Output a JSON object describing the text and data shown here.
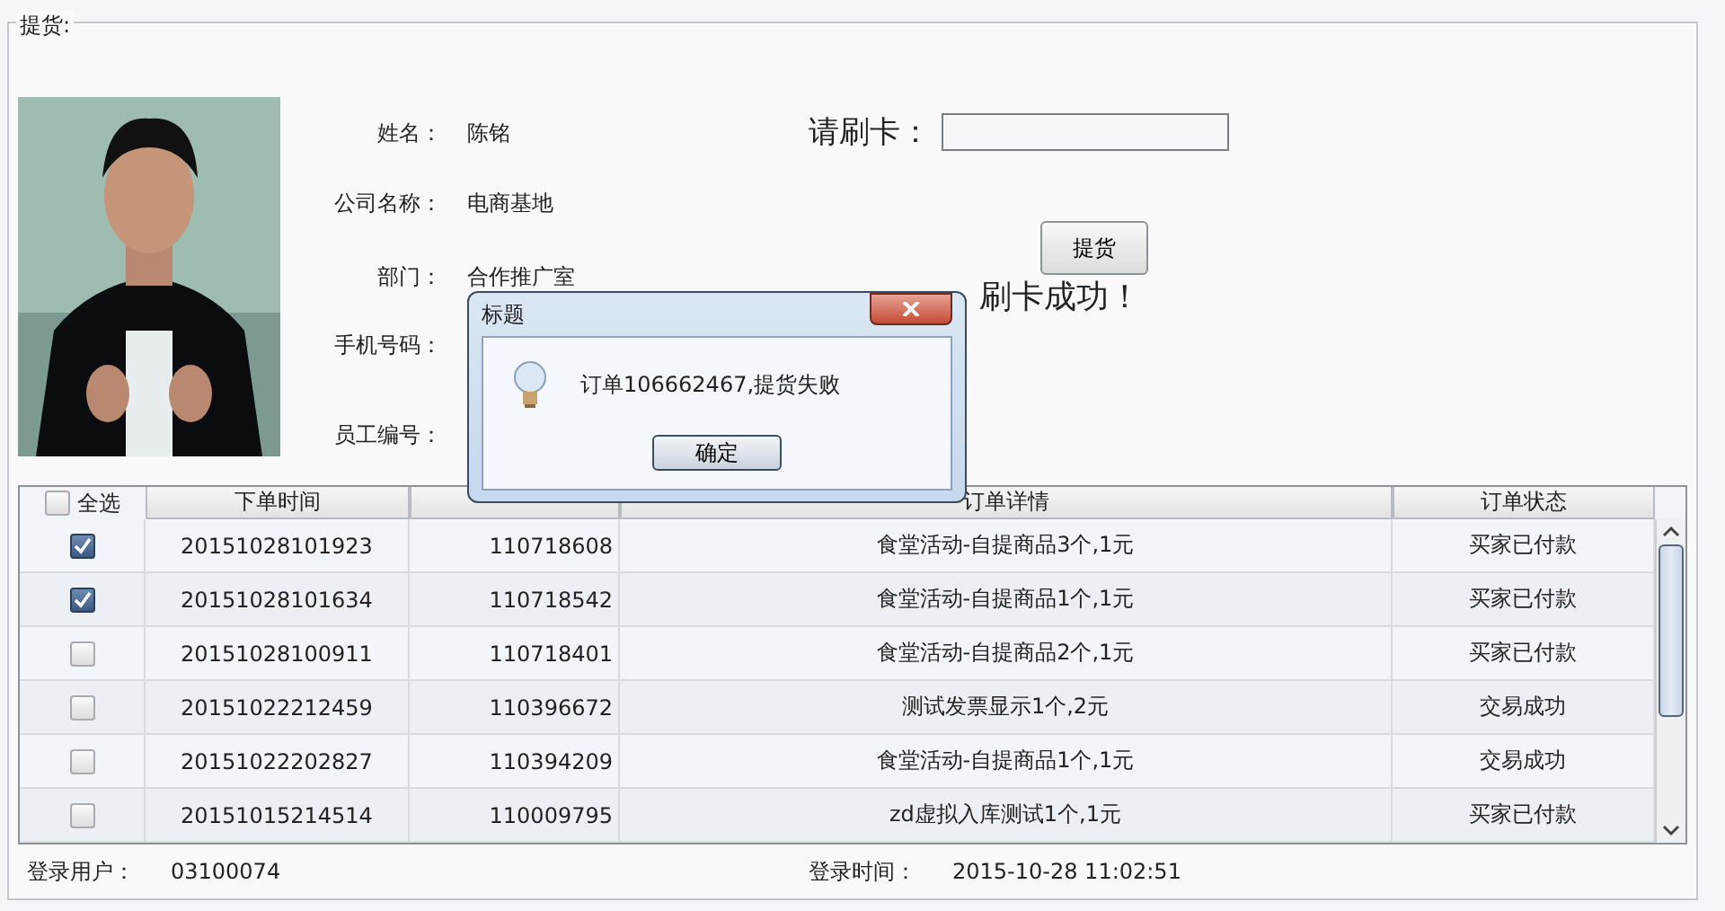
{
  "group_title": "提货:",
  "fields": [
    {
      "label": "姓名：",
      "value": "陈铭"
    },
    {
      "label": "公司名称：",
      "value": "电商基地"
    },
    {
      "label": "部门：",
      "value": "合作推广室"
    },
    {
      "label": "手机号码："
    },
    {
      "label": "员工编号："
    }
  ],
  "card": {
    "label": "请刷卡："
  },
  "pickup_button": "提货",
  "card_status": "刷卡成功！",
  "table": {
    "select_all": {
      "label": "全选",
      "checked": false
    },
    "columns": [
      "下单时间",
      null,
      "订单详情",
      "订单状态"
    ],
    "rows": [
      {
        "checked": true,
        "time": "20151028101923",
        "number": "110718608",
        "detail": "食堂活动-自提商品3个,1元",
        "status": "买家已付款"
      },
      {
        "checked": true,
        "time": "20151028101634",
        "number": "110718542",
        "detail": "食堂活动-自提商品1个,1元",
        "status": "买家已付款"
      },
      {
        "checked": false,
        "time": "20151028100911",
        "number": "110718401",
        "detail": "食堂活动-自提商品2个,1元",
        "status": "买家已付款"
      },
      {
        "checked": false,
        "time": "20151022212459",
        "number": "110396672",
        "detail": "测试发票显示1个,2元",
        "status": "交易成功"
      },
      {
        "checked": false,
        "time": "20151022202827",
        "number": "110394209",
        "detail": "食堂活动-自提商品1个,1元",
        "status": "交易成功"
      },
      {
        "checked": false,
        "time": "20151015214514",
        "number": "110009795",
        "detail": "zd虚拟入库测试1个,1元",
        "status": "买家已付款"
      }
    ]
  },
  "status_bar": {
    "user_label": "登录用户：",
    "user": "03100074",
    "time_label": "登录时间：",
    "time": "2015-10-28 11:02:51"
  },
  "dialog": {
    "title": "标题",
    "message": "订单106662467,提货失败",
    "ok": "确定"
  }
}
